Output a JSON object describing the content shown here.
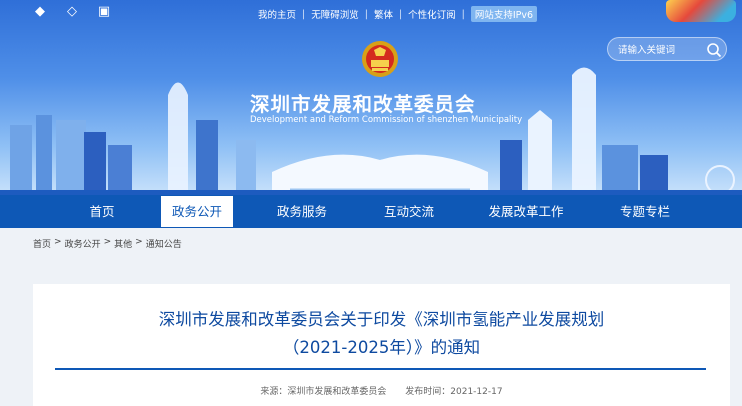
{
  "header": {
    "top_links": [
      "我的主页",
      "无障碍浏览",
      "繁体",
      "个性化订阅",
      "网站支持IPv6"
    ],
    "title_cn": "深圳市发展和改革委员会",
    "title_en": "Development and Reform Commission of shenzhen Municipality",
    "search_placeholder": "请输入关键词"
  },
  "nav": {
    "items": [
      "首页",
      "政务公开",
      "政务服务",
      "互动交流",
      "发展改革工作",
      "专题专栏"
    ],
    "active": "政务公开"
  },
  "breadcrumb": [
    "首页",
    ">",
    "政务公开",
    ">",
    "其他",
    ">",
    "通知公告"
  ],
  "article": {
    "title_line1": "深圳市发展和改革委员会关于印发《深圳市氢能产业发展规划",
    "title_line2": "（2021-2025年）》的通知",
    "source_label": "来源：深圳市发展和改革委员会",
    "date_label": "发布时间：2021-12-17"
  },
  "colors": {
    "nav_bg": "#0e58b6",
    "title_color": "#0e4aa0",
    "page_bg": "#eef2f7"
  }
}
